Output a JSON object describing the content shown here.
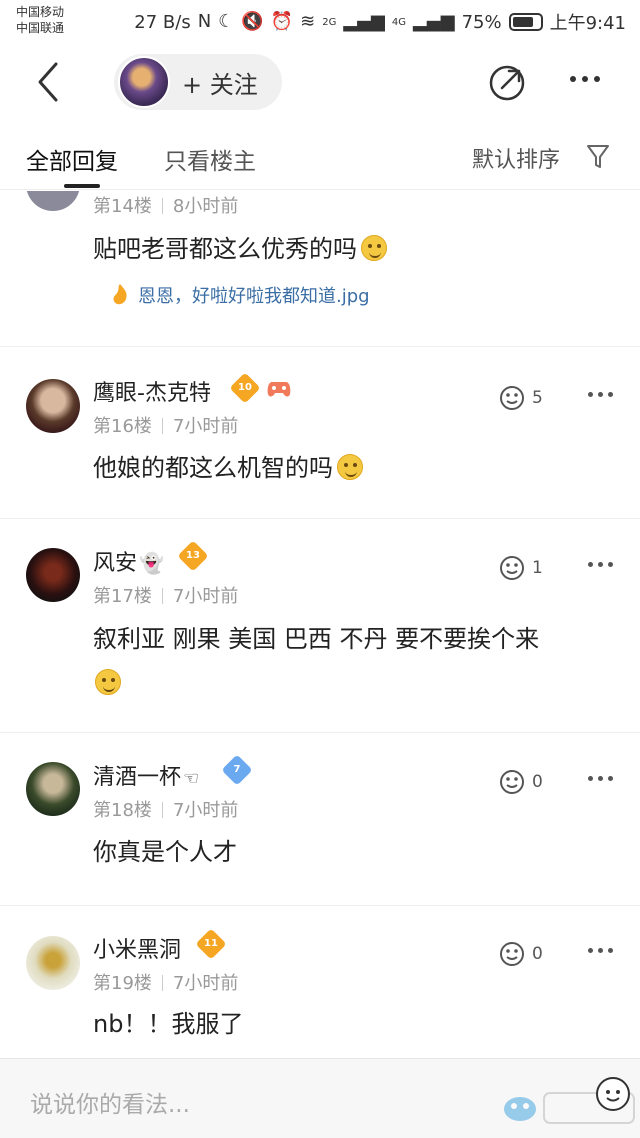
{
  "status_bar": {
    "carrier_1": "中国移动",
    "carrier_2": "中国联通",
    "speed": "27 B/s",
    "signal_1_tag": "2G",
    "signal_2_tag": "4G",
    "battery_pct": "75%",
    "time": "上午9:41"
  },
  "nav": {
    "follow_label": "+ 关注"
  },
  "tabs": {
    "all": "全部回复",
    "owner_only": "只看楼主",
    "sort": "默认排序"
  },
  "replies": [
    {
      "floor": "第14楼",
      "time": "8小时前",
      "content": "贴吧老哥都这么优秀的吗",
      "sub_reply": "恩恩，好啦好啦我都知道.jpg"
    },
    {
      "username": "鹰眼-杰克特",
      "level": "10",
      "floor": "第16楼",
      "time": "7小时前",
      "content": "他娘的都这么机智的吗",
      "likes": "5"
    },
    {
      "username": "风安",
      "level": "13",
      "floor": "第17楼",
      "time": "7小时前",
      "content": "叙利亚 刚果 美国 巴西 不丹 要不要挨个来",
      "likes": "1"
    },
    {
      "username": "清酒一杯",
      "level": "7",
      "floor": "第18楼",
      "time": "7小时前",
      "content": "你真是个人才",
      "likes": "0"
    },
    {
      "username": "小米黑洞",
      "level": "11",
      "floor": "第19楼",
      "time": "7小时前",
      "content": "nb！！我服了",
      "likes": "0"
    }
  ],
  "bottom": {
    "input_placeholder": "说说你的看法..."
  },
  "colors": {
    "level_orange": "#f5a623",
    "level_blue": "#6aa8f0",
    "link_blue": "#3b6ea5"
  }
}
